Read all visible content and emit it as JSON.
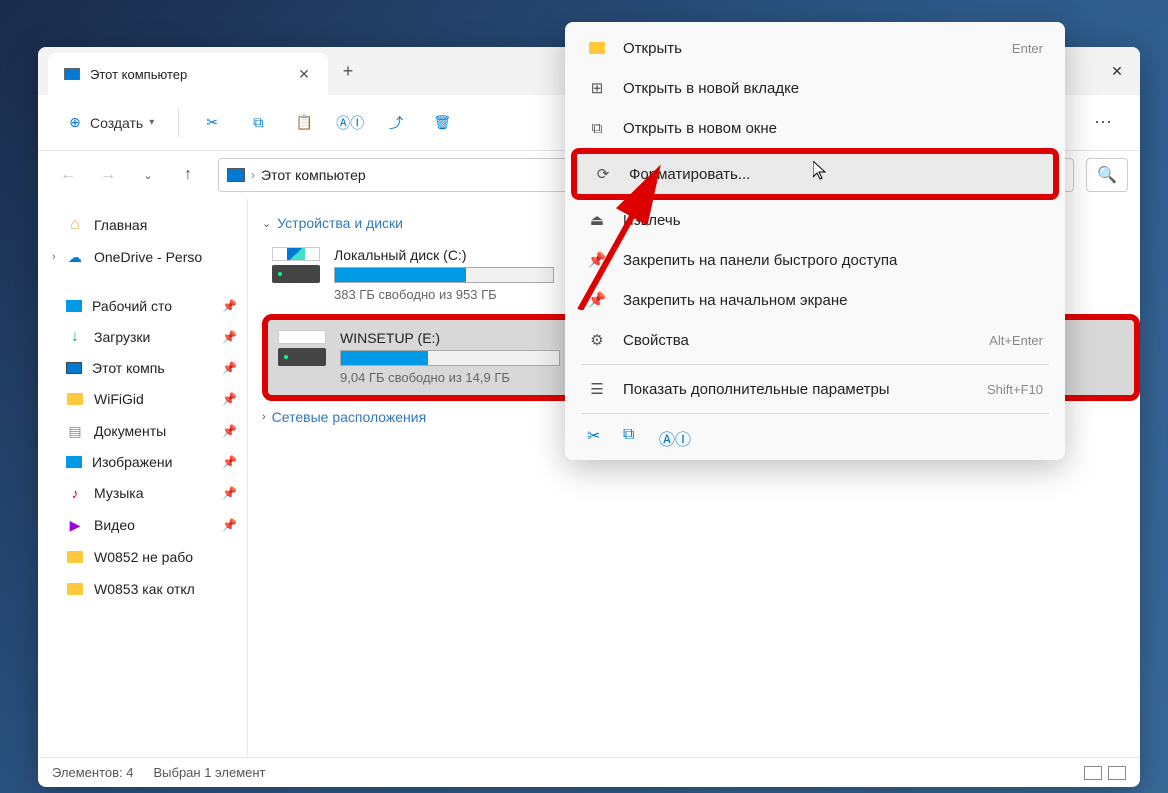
{
  "tab": {
    "title": "Этот компьютер"
  },
  "toolbar": {
    "create": "Создать"
  },
  "breadcrumb": {
    "location": "Этот компьютер"
  },
  "sidebar": {
    "home": "Главная",
    "onedrive": "OneDrive - Perso",
    "desktop": "Рабочий сто",
    "downloads": "Загрузки",
    "thispc": "Этот компь",
    "wifigid": "WiFiGid",
    "documents": "Документы",
    "pictures": "Изображени",
    "music": "Музыка",
    "videos": "Видео",
    "w0852": "W0852 не рабо",
    "w0853": "W0853 как откл"
  },
  "groups": {
    "drives": "Устройства и диски",
    "network": "Сетевые расположения"
  },
  "drives": [
    {
      "name": "Локальный диск (C:)",
      "free": "383 ГБ свободно из 953 ГБ",
      "fill": 60
    },
    {
      "name": "WINSETUP (E:)",
      "free": "9,04 ГБ свободно из 14,9 ГБ",
      "fill": 40
    }
  ],
  "context_menu": {
    "open": "Открыть",
    "open_shortcut": "Enter",
    "open_new_tab": "Открыть в новой вкладке",
    "open_new_window": "Открыть в новом окне",
    "format": "Форматировать...",
    "eject": "Извлечь",
    "pin_quick": "Закрепить на панели быстрого доступа",
    "pin_start": "Закрепить на начальном экране",
    "properties": "Свойства",
    "properties_shortcut": "Alt+Enter",
    "show_more": "Показать дополнительные параметры",
    "show_more_shortcut": "Shift+F10"
  },
  "statusbar": {
    "count": "Элементов: 4",
    "selected": "Выбран 1 элемент"
  }
}
